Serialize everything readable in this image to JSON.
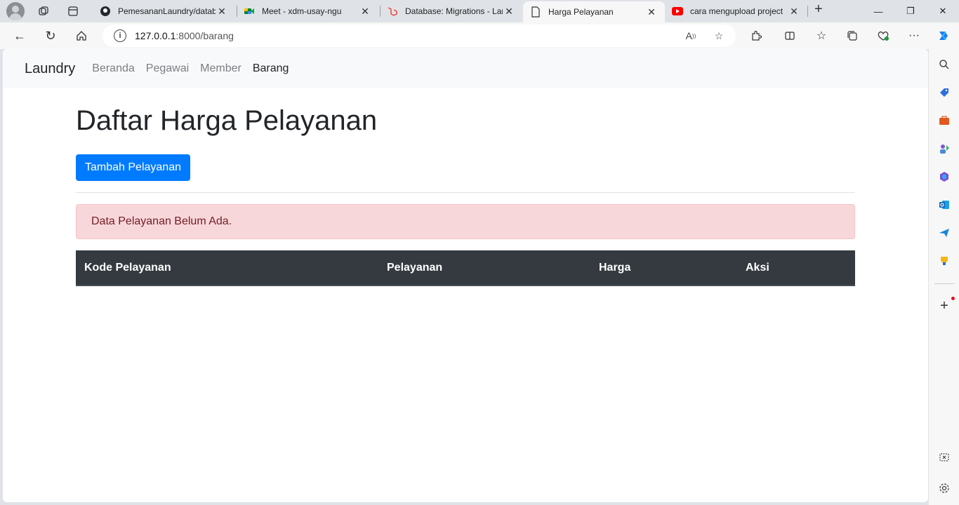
{
  "browser": {
    "tabs": [
      {
        "title": "PemesananLaundry/datab",
        "icon": "github-icon"
      },
      {
        "title": "Meet - xdm-usay-ngu",
        "icon": "meet-icon"
      },
      {
        "title": "Database: Migrations - Lar",
        "icon": "laravel-icon"
      },
      {
        "title": "Harga Pelayanan",
        "icon": "page-icon"
      },
      {
        "title": "cara mengupload project",
        "icon": "youtube-icon"
      }
    ],
    "url_host": "127.0.0.1",
    "url_rest": ":8000/barang",
    "accent": "#0078d4"
  },
  "navbar": {
    "brand": "Laundry",
    "links": [
      "Beranda",
      "Pegawai",
      "Member",
      "Barang"
    ],
    "active": "Barang"
  },
  "main": {
    "title": "Daftar Harga Pelayanan",
    "add_button": "Tambah Pelayanan",
    "alert": "Data Pelayanan Belum Ada.",
    "table_headers": [
      "Kode Pelayanan",
      "Pelayanan",
      "Harga",
      "Aksi"
    ]
  },
  "colors": {
    "primary": "#007bff",
    "alert_bg": "#f8d7da",
    "alert_text": "#721c24",
    "table_header": "#343a40"
  }
}
